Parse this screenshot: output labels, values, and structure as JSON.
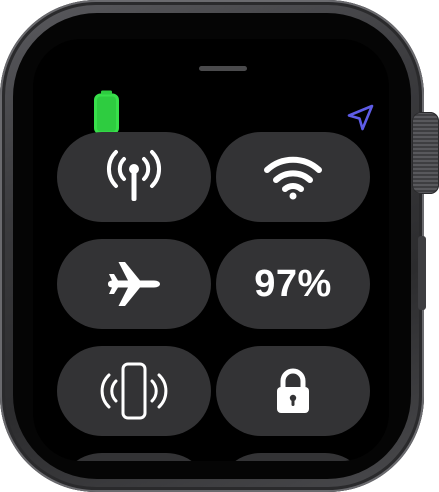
{
  "status": {
    "battery_indicator_color": "#2ecc40",
    "location_indicator_color": "#5e5ce6"
  },
  "tiles": {
    "cellular": {
      "icon": "cellular-antenna-icon"
    },
    "wifi": {
      "icon": "wifi-icon"
    },
    "airplane": {
      "icon": "airplane-icon"
    },
    "battery": {
      "label": "97%"
    },
    "ping_iphone": {
      "icon": "ping-iphone-icon"
    },
    "lock": {
      "icon": "lock-icon"
    }
  },
  "colors": {
    "tile_background": "#333335",
    "icon_color": "#ffffff"
  }
}
